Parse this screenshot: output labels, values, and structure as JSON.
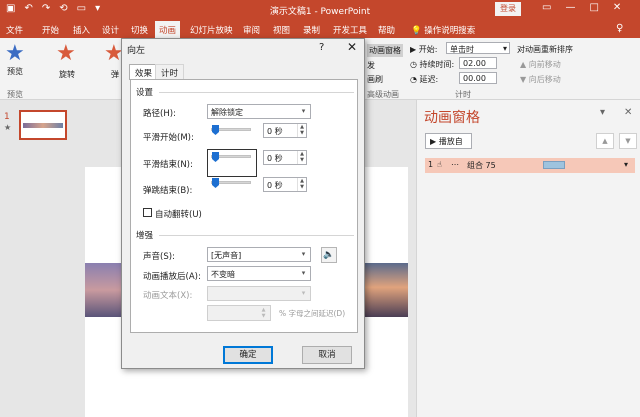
{
  "title_bar": {
    "document_title": "演示文稿1 - PowerPoint",
    "login_label": "登录",
    "qat": [
      "save-icon",
      "undo-icon",
      "redo-icon",
      "repeat-icon",
      "present-icon",
      "customize-icon"
    ]
  },
  "ribbon_tabs": [
    "文件",
    "开始",
    "插入",
    "设计",
    "切换",
    "动画",
    "幻灯片放映",
    "审阅",
    "视图",
    "录制",
    "开发工具",
    "帮助"
  ],
  "ribbon_active_tab": "动画",
  "tell_me": "操作说明搜索",
  "ribbon": {
    "preview_label": "预览",
    "preview_group": "预览",
    "effects": [
      "旋转",
      "弹"
    ],
    "anim_pane_btn": "动画窗格",
    "trigger": "发",
    "painter": "画刷",
    "adv_group": "高级动画",
    "start_label": "开始:",
    "start_value": "单击时",
    "duration_label": "持续时间:",
    "duration_value": "02.00",
    "delay_label": "延迟:",
    "delay_value": "00.00",
    "reorder_title": "对动画重新排序",
    "move_earlier": "向前移动",
    "move_later": "向后移动",
    "timing_group": "计时"
  },
  "slides": {
    "number": "1",
    "marker": "★"
  },
  "animation_pane": {
    "title": "动画窗格",
    "play_label": "播放自",
    "row_index": "1",
    "row_name": "组合 75"
  },
  "dialog": {
    "title": "向左",
    "help": "?",
    "close": "✕",
    "tabs": [
      "效果",
      "计时"
    ],
    "settings_group": "设置",
    "path_label": "路径(H):",
    "path_value": "解除锁定",
    "smooth_start_label": "平滑开始(M):",
    "smooth_start_value": "0 秒",
    "smooth_end_label": "平滑结束(N):",
    "smooth_end_value": "0 秒",
    "bounce_end_label": "弹跳结束(B):",
    "bounce_end_value": "0 秒",
    "auto_reverse_label": "自动翻转(U)",
    "enhance_group": "增强",
    "sound_label": "声音(S):",
    "sound_value": "[无声音]",
    "after_anim_label": "动画播放后(A):",
    "after_anim_value": "不变暗",
    "anim_text_label": "动画文本(X):",
    "anim_text_value": "",
    "letter_delay_label": "% 字母之间延迟(D)",
    "ok_label": "确定",
    "cancel_label": "取消"
  }
}
